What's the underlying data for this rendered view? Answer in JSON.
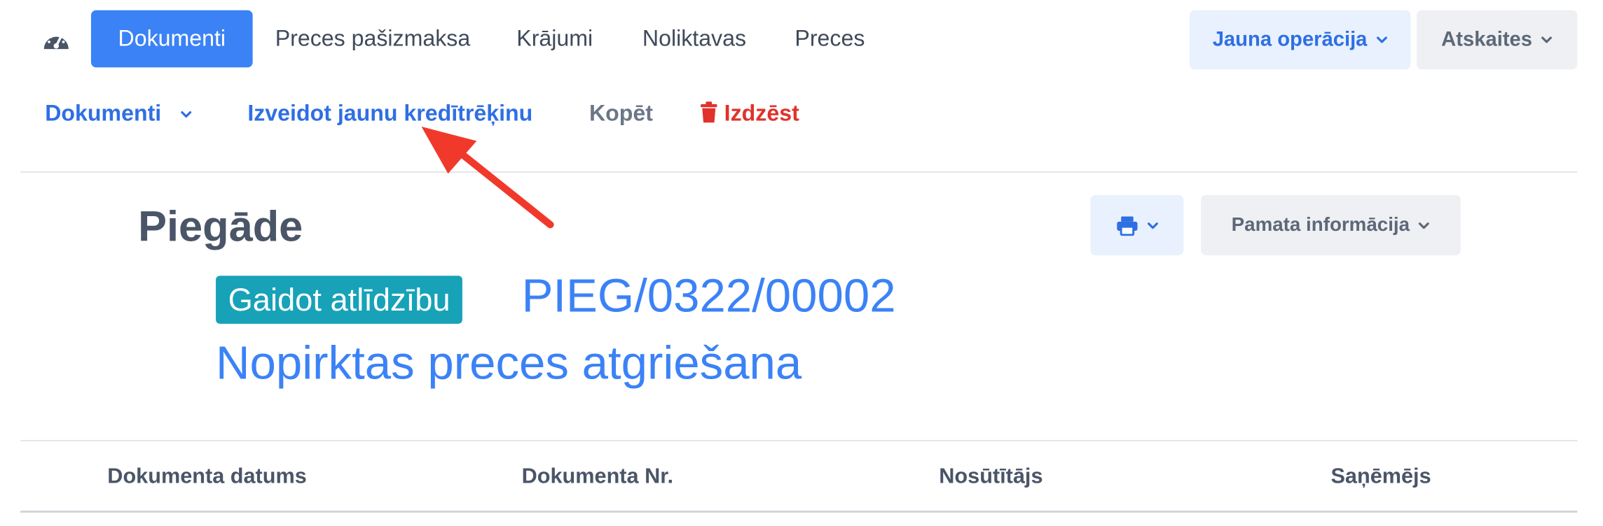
{
  "top_nav": {
    "dashboard_icon": "dashboard-gauge-icon",
    "tabs": [
      {
        "label": "Dokumenti",
        "active": true
      },
      {
        "label": "Preces pašizmaksa",
        "active": false
      },
      {
        "label": "Krājumi",
        "active": false
      },
      {
        "label": "Noliktavas",
        "active": false
      },
      {
        "label": "Preces",
        "active": false
      }
    ],
    "new_operation_label": "Jauna operācija",
    "reports_label": "Atskaites"
  },
  "actions": {
    "documents_label": "Dokumenti",
    "create_credit_note_label": "Izveidot jaunu kredītrēķinu",
    "copy_label": "Kopēt",
    "delete_label": "Izdzēst"
  },
  "document": {
    "type": "Piegāde",
    "status": "Gaidot atlīdzību",
    "number": "PIEG/0322/00002",
    "subtitle": "Nopirktas preces atgriešana",
    "print_icon": "printer-icon",
    "basic_info_label": "Pamata informācija"
  },
  "table": {
    "headers": [
      "Dokumenta datums",
      "Dokumenta Nr.",
      "Nosūtītājs",
      "Saņēmējs"
    ]
  },
  "colors": {
    "primary": "#3b82f6",
    "link": "#2f6fe4",
    "danger": "#e0322b",
    "status_badge": "#17a2b8",
    "heading": "#4a5568",
    "annotation_arrow": "#f0392b"
  }
}
